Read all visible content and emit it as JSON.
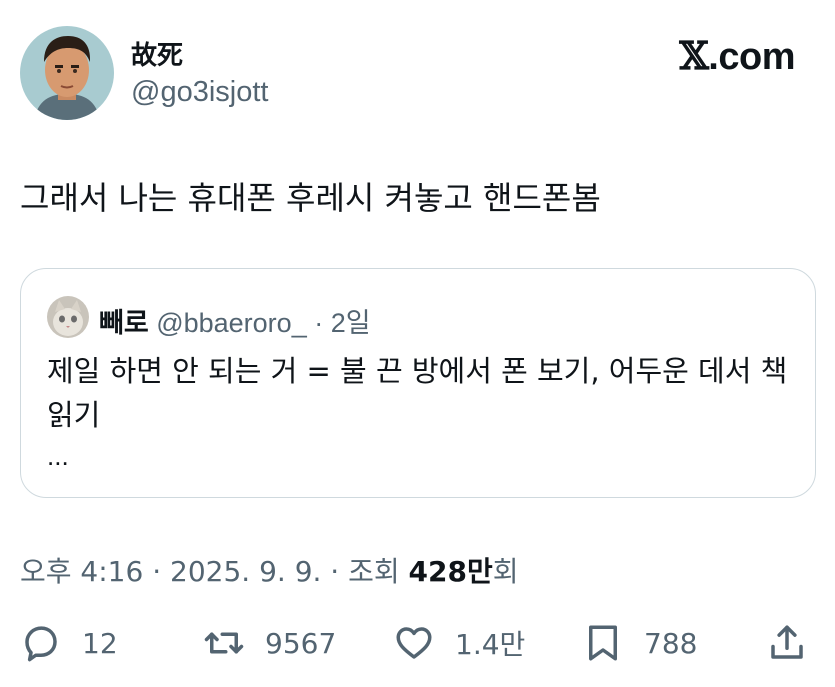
{
  "author": {
    "display_name": "故死",
    "handle": "@go3isjott",
    "avatar_icon": "avatar-man-icon"
  },
  "brand": {
    "mark": "𝕏",
    "text": ".com"
  },
  "tweet": {
    "text": "그래서 나는 휴대폰 후레시 켜놓고 핸드폰봄"
  },
  "quote": {
    "avatar_icon": "cat-avatar-icon",
    "display_name": "빼로",
    "handle": "@bbaeroro_",
    "separator": " · ",
    "time": "2일",
    "body": "제일 하면 안 되는 거 = 불 끈 방에서 폰 보기, 어두운 데서 책 읽기",
    "more": "..."
  },
  "meta": {
    "time": "오후 4:16",
    "date": "2025. 9. 9.",
    "views_label": "조회",
    "views_count": "428만",
    "views_suffix": "회",
    "sep": " · "
  },
  "actions": {
    "replies": "12",
    "reposts": "9567",
    "likes": "1.4만",
    "bookmarks": "788"
  },
  "colors": {
    "text": "#0f1419",
    "secondary": "#536471",
    "border": "#cfd9de"
  }
}
